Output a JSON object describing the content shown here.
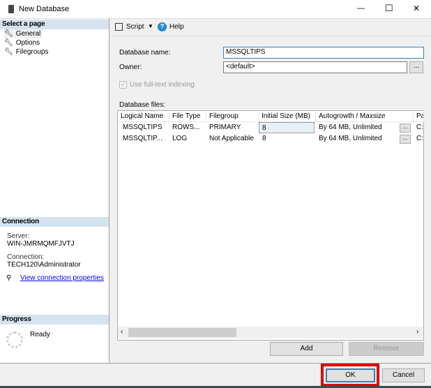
{
  "window": {
    "title": "New Database",
    "icon": "database-icon",
    "minimize": "—",
    "maximize": "☐",
    "close": "✕"
  },
  "sidebar": {
    "select_page": "Select a page",
    "pages": [
      {
        "label": "General"
      },
      {
        "label": "Options"
      },
      {
        "label": "Filegroups"
      }
    ],
    "connection_header": "Connection",
    "server_label": "Server:",
    "server_value": "WIN-JMRMQMFJVTJ",
    "connection_label": "Connection:",
    "connection_value": "TECH120\\Administrator",
    "view_props": "View connection properties",
    "progress_header": "Progress",
    "progress_status": "Ready"
  },
  "toolbar": {
    "script": "Script",
    "help": "Help"
  },
  "form": {
    "db_name_label": "Database name:",
    "db_name_value": "MSSQLTIPS",
    "owner_label": "Owner:",
    "owner_value": "<default>",
    "browse": "...",
    "fulltext_label": "Use full-text indexing",
    "db_files_label": "Database files:"
  },
  "grid": {
    "columns": [
      "Logical Name",
      "File Type",
      "Filegroup",
      "Initial Size (MB)",
      "Autogrowth / Maxsize",
      "Pa"
    ],
    "rows": [
      [
        "MSSQLTIPS",
        "ROWS...",
        "PRIMARY",
        "8",
        "By 64 MB, Unlimited",
        "C:"
      ],
      [
        "MSSQLTIP...",
        "LOG",
        "Not Applicable",
        "8",
        "By 64 MB, Unlimited",
        "C:"
      ]
    ],
    "ellipsis": "..."
  },
  "buttons": {
    "add": "Add",
    "remove": "Remove",
    "ok": "OK",
    "cancel": "Cancel"
  },
  "colors": {
    "highlight": "#e00000",
    "header": "#d5e3f0",
    "link": "#0000ee"
  }
}
